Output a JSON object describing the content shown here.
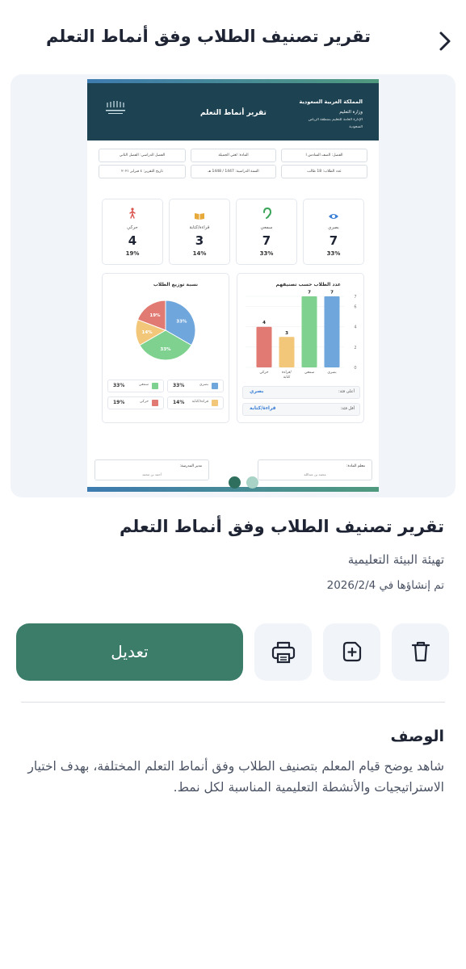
{
  "header": {
    "title": "تقرير تصنيف الطلاب وفق أنماط التعلم",
    "back_icon": "chevron-right-icon"
  },
  "doc": {
    "kingdom": "المملكة العربية السعودية",
    "ministry": "وزارة التعليم",
    "admin_line1": "الإدارة العامة للتعليم بمنطقة الرياض",
    "admin_line2": "السعودية",
    "title": "تقرير أنماط التعلم",
    "info": {
      "grade": "الفصل: الصف السادس ا",
      "school": "المادة: لغتي الجميلة",
      "semester": "الفصل الدراسي: الفصل الثاني",
      "students": "عدد الطلاب: 18 طالب",
      "year": "السنة الدراسية: 1447 / 1448 هـ",
      "date": "تاريخ التقرير: ٤ فبراير ٢٠٢١"
    },
    "stats": [
      {
        "label": "بصري",
        "value": "7",
        "pct": "33%",
        "color": "#3a7fd5",
        "icon": "eye-icon"
      },
      {
        "label": "سمعي",
        "value": "7",
        "pct": "33%",
        "color": "#3aa55a",
        "icon": "ear-icon"
      },
      {
        "label": "قراءة/كتابة",
        "value": "3",
        "pct": "14%",
        "color": "#e6a93a",
        "icon": "book-icon"
      },
      {
        "label": "حركي",
        "value": "4",
        "pct": "19%",
        "color": "#d9534f",
        "icon": "walking-icon"
      }
    ],
    "bar_title": "عدد الطلاب حسب تصنيفهم",
    "pie_title": "نسبة توزيع الطلاب",
    "highest_label": "أعلى فئة:",
    "highest_value": "بصري",
    "lowest_label": "أقل فئة:",
    "lowest_value": "قراءة/كتابة",
    "legend": [
      {
        "label": "بصري",
        "pct": "33%",
        "color": "#6fa6dc"
      },
      {
        "label": "سمعي",
        "pct": "33%",
        "color": "#7fd18f"
      },
      {
        "label": "قراءة/كتابة",
        "pct": "14%",
        "color": "#f2c77a"
      },
      {
        "label": "حركي",
        "pct": "19%",
        "color": "#e07a72"
      }
    ],
    "teacher_title": "معلم المادة:",
    "teacher_name": "محمد بن عبدالله",
    "principal_title": "مدير المدرسة:",
    "principal_name": "أحمد بن محمد"
  },
  "chart_data": [
    {
      "type": "bar",
      "title": "عدد الطلاب حسب تصنيفهم",
      "categories": [
        "بصري",
        "سمعي",
        "قراءة/ كتابة",
        "حركي"
      ],
      "values": [
        7,
        7,
        3,
        4
      ],
      "colors": [
        "#6fa6dc",
        "#7fd18f",
        "#f2c77a",
        "#e07a72"
      ],
      "ylim": [
        0,
        7
      ],
      "yticks": [
        "0",
        "2",
        "4",
        "6",
        "7"
      ]
    },
    {
      "type": "pie",
      "title": "نسبة توزيع الطلاب",
      "labels": [
        "بصري",
        "سمعي",
        "قراءة/كتابة",
        "حركي"
      ],
      "values": [
        33,
        33,
        14,
        19
      ],
      "slice_labels": [
        "33%",
        "33%",
        "14%",
        "19%"
      ],
      "colors": [
        "#6fa6dc",
        "#7fd18f",
        "#f2c77a",
        "#e07a72"
      ]
    }
  ],
  "carousel": {
    "active_index": 0,
    "count": 2
  },
  "main_title": "تقرير تصنيف الطلاب وفق أنماط التعلم",
  "category": "تهيئة البيئة التعليمية",
  "created": "تم إنشاؤها في 2026/2/4",
  "actions": {
    "edit_label": "تعديل",
    "delete_icon": "trash-icon",
    "duplicate_icon": "copy-plus-icon",
    "print_icon": "printer-icon"
  },
  "description": {
    "heading": "الوصف",
    "text": "شاهد يوضح قيام المعلم بتصنيف الطلاب وفق أنماط التعلم المختلفة، بهدف اختيار الاستراتيجيات والأنشطة التعليمية المناسبة لكل نمط."
  }
}
